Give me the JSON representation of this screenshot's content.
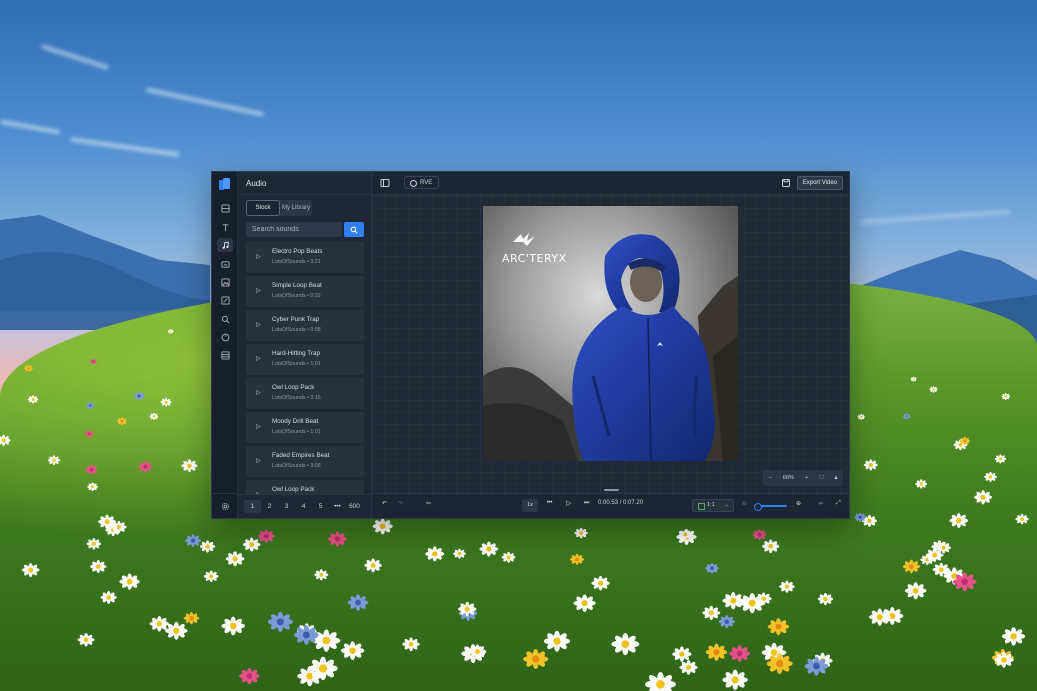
{
  "app": {
    "panel_title": "Audio",
    "tabs": [
      "Stock",
      "My Library"
    ],
    "search_placeholder": "Search sounds",
    "tracks": [
      {
        "name": "Electro Pop Beats",
        "meta": "LotsOfSounds • 0:21"
      },
      {
        "name": "Simple Loop Beat",
        "meta": "LotsOfSounds • 0:32"
      },
      {
        "name": "Cyber Punk Trap",
        "meta": "LotsOfSounds • 0:58"
      },
      {
        "name": "Hard-Hitting Trap",
        "meta": "LotsOfSounds • 1:01"
      },
      {
        "name": "Owl Loop Pack",
        "meta": "LotsOfSounds • 0:15"
      },
      {
        "name": "Moody Drill Beat",
        "meta": "LotsOfSounds • 1:01"
      },
      {
        "name": "Faded Empires Beat",
        "meta": "LotsOfSounds • 3:06"
      },
      {
        "name": "Owl Loop Pack",
        "meta": ""
      }
    ],
    "pager": [
      "1",
      "2",
      "3",
      "4",
      "5",
      "•••",
      "600"
    ],
    "project_name": "RVE",
    "export_label": "Export Video",
    "canvas_brand": "ARC'TERYX",
    "zoom_level": "66%",
    "speed": "1x",
    "time_current": "0:00.53",
    "time_total": "0:07.20",
    "aspect_ratio": "1:1"
  },
  "colors": {
    "accent": "#2f7ff5",
    "window_bg": "#1b2533",
    "panel_bg": "#1d2736",
    "item_bg": "#27323f",
    "jacket_blue": "#1f3a9c"
  }
}
